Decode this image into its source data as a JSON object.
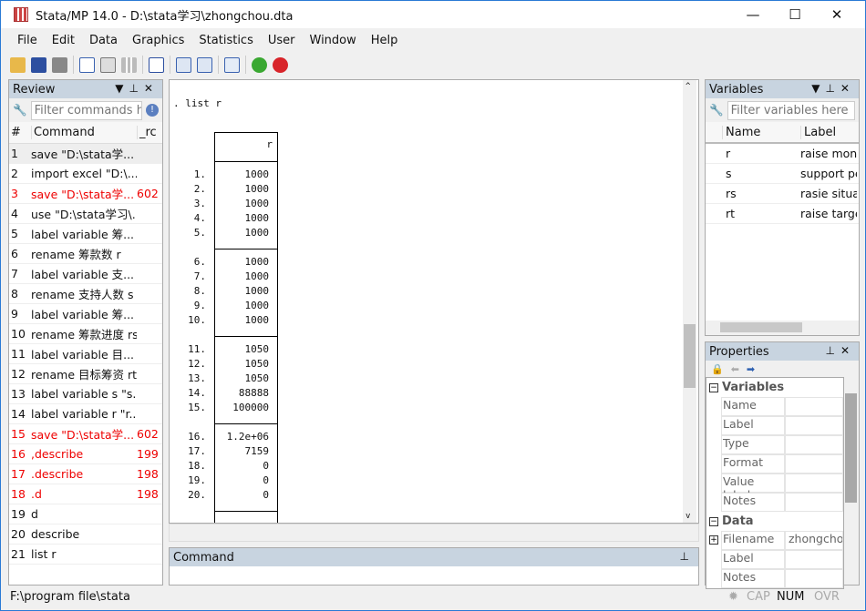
{
  "window": {
    "title": "Stata/MP 14.0 - D:\\stata学习\\zhongchou.dta",
    "minimize": "—",
    "maximize": "☐",
    "close": "✕"
  },
  "menu": [
    "File",
    "Edit",
    "Data",
    "Graphics",
    "Statistics",
    "User",
    "Window",
    "Help"
  ],
  "toolbar": [
    "open-icon",
    "save-icon",
    "print-icon",
    "log-icon",
    "viewer-icon",
    "graph-icon",
    "do-file-editor-icon",
    "data-editor-icon",
    "data-browser-icon",
    "variables-manager-icon",
    "more-icon",
    "break-icon"
  ],
  "review": {
    "title": "Review",
    "filter_placeholder": "Filter commands he",
    "col_num": "#",
    "col_command": "Command",
    "col_rc": "_rc",
    "items": [
      {
        "n": "1",
        "cmd": "save \"D:\\stata学...",
        "rc": "",
        "err": false
      },
      {
        "n": "2",
        "cmd": "import excel \"D:\\...",
        "rc": "",
        "err": false
      },
      {
        "n": "3",
        "cmd": "save \"D:\\stata学...",
        "rc": "602",
        "err": true
      },
      {
        "n": "4",
        "cmd": "use \"D:\\stata学习\\...",
        "rc": "",
        "err": false
      },
      {
        "n": "5",
        "cmd": "label variable 筹...",
        "rc": "",
        "err": false
      },
      {
        "n": "6",
        "cmd": "rename 筹款数 r",
        "rc": "",
        "err": false
      },
      {
        "n": "7",
        "cmd": "label variable 支...",
        "rc": "",
        "err": false
      },
      {
        "n": "8",
        "cmd": "rename 支持人数 s",
        "rc": "",
        "err": false
      },
      {
        "n": "9",
        "cmd": "label variable 筹...",
        "rc": "",
        "err": false
      },
      {
        "n": "10",
        "cmd": "rename 筹款进度 rs",
        "rc": "",
        "err": false
      },
      {
        "n": "11",
        "cmd": "label variable 目...",
        "rc": "",
        "err": false
      },
      {
        "n": "12",
        "cmd": "rename 目标筹资 rt",
        "rc": "",
        "err": false
      },
      {
        "n": "13",
        "cmd": "label variable s \"s...",
        "rc": "",
        "err": false
      },
      {
        "n": "14",
        "cmd": "label variable r \"r...",
        "rc": "",
        "err": false
      },
      {
        "n": "15",
        "cmd": "save \"D:\\stata学...",
        "rc": "602",
        "err": true
      },
      {
        "n": "16",
        "cmd": ",describe",
        "rc": "199",
        "err": true
      },
      {
        "n": "17",
        "cmd": ".describe",
        "rc": "198",
        "err": true
      },
      {
        "n": "18",
        "cmd": ".d",
        "rc": "198",
        "err": true
      },
      {
        "n": "19",
        "cmd": "d",
        "rc": "",
        "err": false
      },
      {
        "n": "20",
        "cmd": "describe",
        "rc": "",
        "err": false
      },
      {
        "n": "21",
        "cmd": "list r",
        "rc": "",
        "err": false
      }
    ]
  },
  "results": {
    "command": ". list r",
    "header": "r",
    "rows": [
      [
        "1.",
        "1000"
      ],
      [
        "2.",
        "1000"
      ],
      [
        "3.",
        "1000"
      ],
      [
        "4.",
        "1000"
      ],
      [
        "5.",
        "1000"
      ],
      [
        "6.",
        "1000"
      ],
      [
        "7.",
        "1000"
      ],
      [
        "8.",
        "1000"
      ],
      [
        "9.",
        "1000"
      ],
      [
        "10.",
        "1000"
      ],
      [
        "11.",
        "1050"
      ],
      [
        "12.",
        "1050"
      ],
      [
        "13.",
        "1050"
      ],
      [
        "14.",
        "88888"
      ],
      [
        "15.",
        "100000"
      ],
      [
        "16.",
        "1.2e+06"
      ],
      [
        "17.",
        "7159"
      ],
      [
        "18.",
        "0"
      ],
      [
        "19.",
        "0"
      ],
      [
        "20.",
        "0"
      ]
    ]
  },
  "command_panel": {
    "title": "Command"
  },
  "variables": {
    "title": "Variables",
    "filter_placeholder": "Filter variables here",
    "col_name": "Name",
    "col_label": "Label",
    "items": [
      {
        "name": "r",
        "label": "raise money"
      },
      {
        "name": "s",
        "label": "support people"
      },
      {
        "name": "rs",
        "label": "rasie situation"
      },
      {
        "name": "rt",
        "label": "raise target"
      }
    ]
  },
  "properties": {
    "title": "Properties",
    "variables_section": "Variables",
    "variables_fields": [
      "Name",
      "Label",
      "Type",
      "Format",
      "Value label",
      "Notes"
    ],
    "data_section": "Data",
    "data_fields": [
      {
        "k": "Filename",
        "v": "zhongchou.dta"
      },
      {
        "k": "Label",
        "v": ""
      },
      {
        "k": "Notes",
        "v": ""
      }
    ]
  },
  "status": {
    "path": "F:\\program file\\stata",
    "cap": "CAP",
    "num": "NUM",
    "ovr": "OVR"
  }
}
